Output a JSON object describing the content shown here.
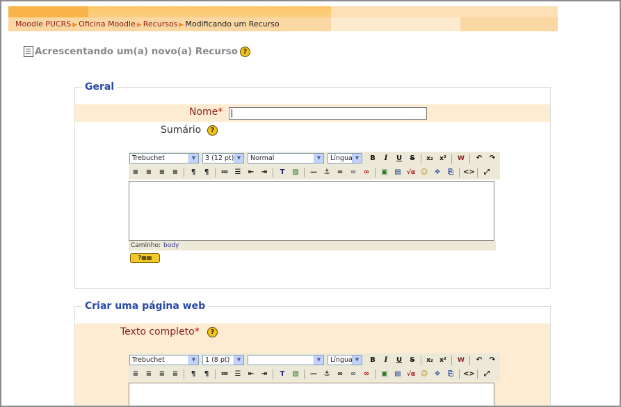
{
  "breadcrumb": {
    "items": [
      "Moodle PUCRS",
      "Oficina Moodle",
      "Recursos"
    ],
    "current": "Modificando um Recurso",
    "separator": "▶"
  },
  "page": {
    "title": "Acrescentando um(a) novo(a) Recurso",
    "help_glyph": "?"
  },
  "section_geral": {
    "legend": "Geral",
    "name_label": "Nome",
    "name_required": "*",
    "name_value": "",
    "summary_label": "Sumário"
  },
  "editor_summary": {
    "font": "Trebuchet",
    "size": "3 (12 pt)",
    "format": "Normal",
    "language": "Língua",
    "path_label": "Caminho:",
    "path_value": "body"
  },
  "section_web": {
    "legend": "Criar uma página web",
    "full_text_label": "Texto completo",
    "full_text_required": "*"
  },
  "editor_full": {
    "font": "Trebuchet",
    "size": "1 (8 pt)",
    "format": "",
    "language": "Língua"
  },
  "toolbar_icons": {
    "bold": "B",
    "italic": "I",
    "underline": "U",
    "strike": "S",
    "subscript": "x₂",
    "superscript": "x²",
    "undo": "↶",
    "redo": "↷",
    "align_left": "≡",
    "align_center": "≡",
    "align_right": "≡",
    "justify": "≡",
    "ltr": "¶",
    "rtl": "¶",
    "ordered_list": "≔",
    "unordered_list": "☰",
    "outdent": "⇤",
    "indent": "⇥",
    "text_color": "T",
    "bg_color": "▧",
    "hr": "—",
    "anchor": "⚓",
    "link": "∞",
    "unlink": "∞",
    "nolink": "∞",
    "image": "▣",
    "table": "▤",
    "tex": "√α",
    "smiley": "☺",
    "special_char": "❖",
    "search": "⎘",
    "html": "<>",
    "fullscreen": "⤢"
  },
  "colors": {
    "legend": "#2a4aa8",
    "required_label": "#8b2020",
    "band": "#fdecd2",
    "breadcrumb_link": "#8b1d1d"
  }
}
